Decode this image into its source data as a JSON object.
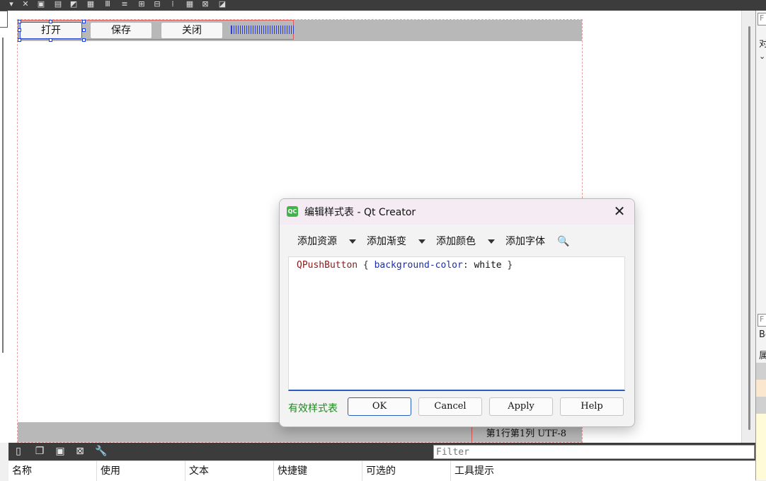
{
  "form": {
    "buttons": [
      "打开",
      "保存",
      "关闭"
    ],
    "status": "第1行第1列  UTF-8"
  },
  "right_panel": {
    "items": [
      "F",
      "对",
      "F",
      "Be",
      "属"
    ]
  },
  "action_editor": {
    "filter_placeholder": "Filter",
    "columns": [
      "名称",
      "使用",
      "文本",
      "快捷键",
      "可选的",
      "工具提示"
    ]
  },
  "dialog": {
    "title": "编辑样式表 - Qt Creator",
    "logo_text": "QC",
    "close_glyph": "✕",
    "tools": [
      "添加资源",
      "添加渐变",
      "添加颜色",
      "添加字体"
    ],
    "stylesheet": {
      "selector": "QPushButton",
      "open_brace": " { ",
      "property": "background-color",
      "colon": ": ",
      "value": "white",
      "close_brace": " }"
    },
    "valid_label": "有效样式表",
    "buttons": {
      "ok": "OK",
      "cancel": "Cancel",
      "apply": "Apply",
      "help": "Help"
    }
  },
  "colors": {
    "selector": "#8b1a1a",
    "property": "#1a2fa8",
    "valid": "#1d8a1d",
    "selection_handle": "#1a3fd8",
    "layout_border": "#e05a5a"
  }
}
